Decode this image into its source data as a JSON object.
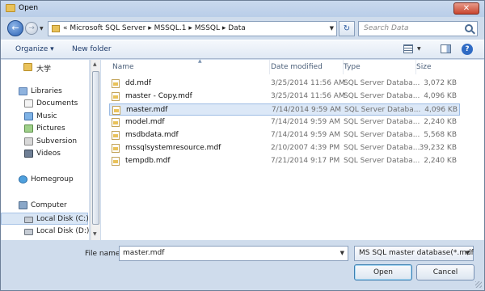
{
  "window": {
    "title": "Open",
    "close_label": "✕"
  },
  "address": {
    "path": "« Microsoft SQL Server ▸ MSSQL.1 ▸ MSSQL ▸ Data",
    "search_placeholder": "Search Data"
  },
  "toolbar": {
    "organize": "Organize ▾",
    "new_folder": "New folder",
    "help": "?"
  },
  "nav": {
    "items": [
      {
        "label": "大学",
        "icon": "folder-icon"
      },
      {
        "label": "Libraries",
        "icon": "library-icon"
      },
      {
        "label": "Documents",
        "icon": "documents-icon"
      },
      {
        "label": "Music",
        "icon": "music-icon"
      },
      {
        "label": "Pictures",
        "icon": "pictures-icon"
      },
      {
        "label": "Subversion",
        "icon": "subversion-icon"
      },
      {
        "label": "Videos",
        "icon": "videos-icon"
      },
      {
        "label": "Homegroup",
        "icon": "homegroup-icon"
      },
      {
        "label": "Computer",
        "icon": "computer-icon"
      },
      {
        "label": "Local Disk (C:)",
        "icon": "disk-icon"
      },
      {
        "label": "Local Disk (D:)",
        "icon": "disk-icon"
      }
    ]
  },
  "files": {
    "columns": [
      "Name",
      "Date modified",
      "Type",
      "Size"
    ],
    "rows": [
      {
        "name": "dd.mdf",
        "date": "3/25/2014 11:56 AM",
        "type": "SQL Server Databa...",
        "size": "3,072 KB"
      },
      {
        "name": "master - Copy.mdf",
        "date": "3/25/2014 11:56 AM",
        "type": "SQL Server Databa...",
        "size": "4,096 KB"
      },
      {
        "name": "master.mdf",
        "date": "7/14/2014 9:59 AM",
        "type": "SQL Server Databa...",
        "size": "4,096 KB"
      },
      {
        "name": "model.mdf",
        "date": "7/14/2014 9:59 AM",
        "type": "SQL Server Databa...",
        "size": "2,240 KB"
      },
      {
        "name": "msdbdata.mdf",
        "date": "7/14/2014 9:59 AM",
        "type": "SQL Server Databa...",
        "size": "5,568 KB"
      },
      {
        "name": "mssqlsystemresource.mdf",
        "date": "2/10/2007 4:39 PM",
        "type": "SQL Server Databa...",
        "size": "39,232 KB"
      },
      {
        "name": "tempdb.mdf",
        "date": "7/21/2014 9:17 PM",
        "type": "SQL Server Databa...",
        "size": "2,240 KB"
      }
    ],
    "selected_index": 2
  },
  "footer": {
    "filename_label": "File name:",
    "filename_value": "master.mdf",
    "filter_value": "MS SQL master database(*.mdf",
    "open_label": "Open",
    "cancel_label": "Cancel"
  }
}
